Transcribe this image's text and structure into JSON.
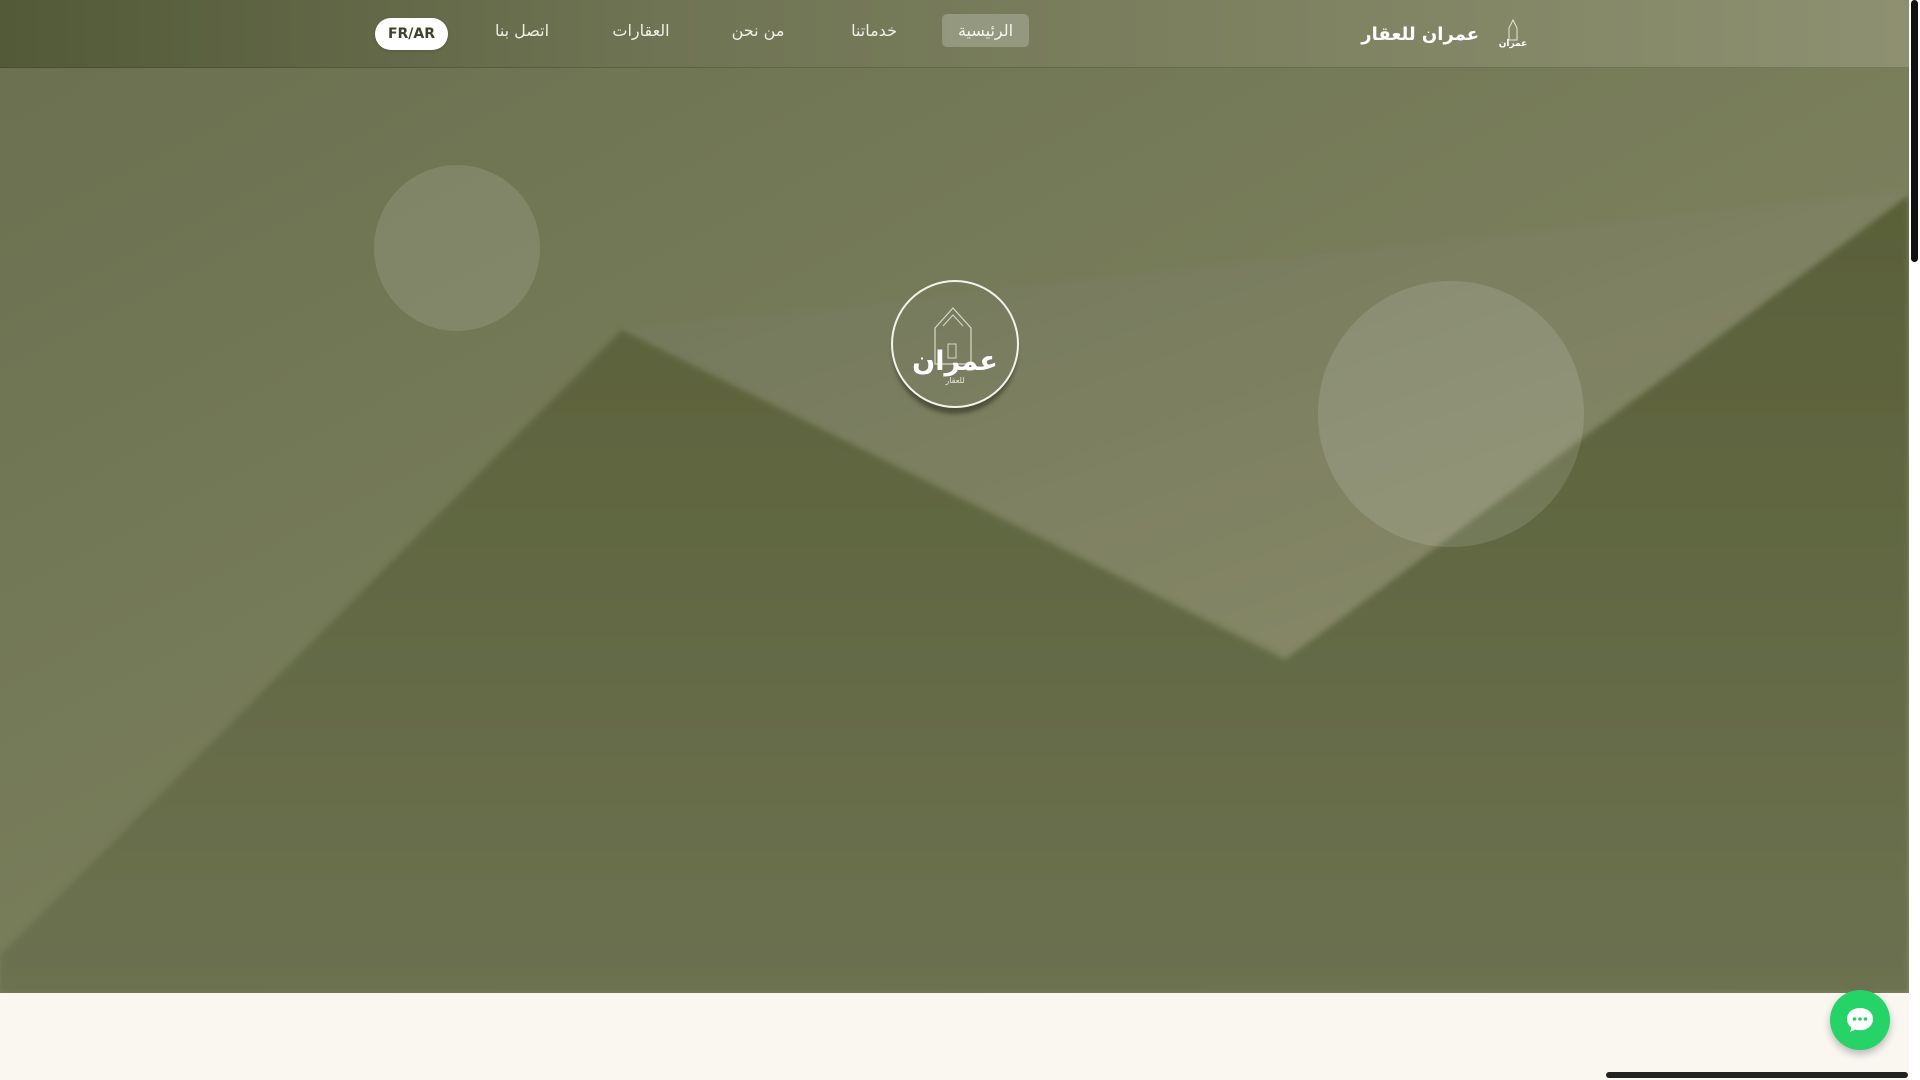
{
  "colors": {
    "navbar_start": "#535a38",
    "navbar_end": "#8e9171",
    "hero_bg": "#6b7050",
    "accent_light": "#8a8c6a",
    "page_bg": "#f9f7f0",
    "chat_green": "#25d366"
  },
  "header": {
    "brand_name": "عمران للعقار",
    "brand_logo_icon": "omran-logo-icon",
    "lang_toggle": "FR/AR",
    "nav": {
      "home": "الرئيسية",
      "services": "خدماتنا",
      "about": "من نحن",
      "properties": "العقارات",
      "contact": "اتصل بنا"
    },
    "active_nav": "home"
  },
  "hero": {
    "logo_text": "عمران",
    "logo_subtext": "للعقار",
    "logo_icon": "house-outline-icon"
  },
  "chat": {
    "icon": "chat-bubble-icon"
  }
}
